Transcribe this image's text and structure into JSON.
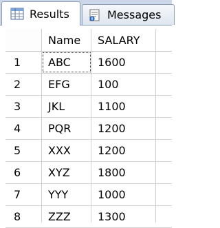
{
  "tabs": [
    {
      "label": "Results",
      "icon": "grid-icon",
      "active": true
    },
    {
      "label": "Messages",
      "icon": "messages-icon",
      "active": false
    }
  ],
  "table": {
    "columns": [
      "Name",
      "SALARY"
    ],
    "rows": [
      {
        "num": "1",
        "name": "ABC",
        "salary": "1600"
      },
      {
        "num": "2",
        "name": "EFG",
        "salary": "100"
      },
      {
        "num": "3",
        "name": "JKL",
        "salary": "1100"
      },
      {
        "num": "4",
        "name": "PQR",
        "salary": "1200"
      },
      {
        "num": "5",
        "name": "XXX",
        "salary": "1200"
      },
      {
        "num": "6",
        "name": "XYZ",
        "salary": "1800"
      },
      {
        "num": "7",
        "name": "YYY",
        "salary": "1000"
      },
      {
        "num": "8",
        "name": "ZZZ",
        "salary": "1300"
      }
    ]
  },
  "colors": {
    "tabstrip": "#ccd8ea",
    "gridline": "#d0d0d0"
  }
}
